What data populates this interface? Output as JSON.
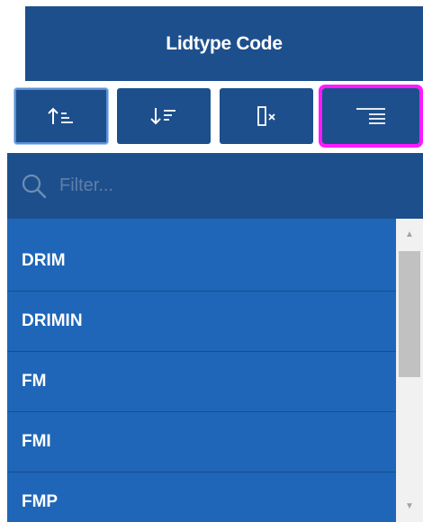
{
  "header": {
    "title": "Lidtype Code"
  },
  "toolbar": {
    "buttons": [
      {
        "name": "sort-ascending",
        "icon": "sort-ascending-icon",
        "active": true
      },
      {
        "name": "sort-descending",
        "icon": "sort-descending-icon",
        "active": false
      },
      {
        "name": "clear-filter",
        "icon": "clear-column-icon",
        "active": false
      },
      {
        "name": "filter-menu",
        "icon": "filter-lines-icon",
        "highlighted": true
      }
    ]
  },
  "filter": {
    "placeholder": "Filter...",
    "value": ""
  },
  "list": {
    "items": [
      "DRIM",
      "DRIMIN",
      "FM",
      "FMI",
      "FMP"
    ]
  },
  "colors": {
    "header_bg": "#1d4f8c",
    "list_bg": "#1f66b8",
    "highlight": "#ff19ff"
  }
}
